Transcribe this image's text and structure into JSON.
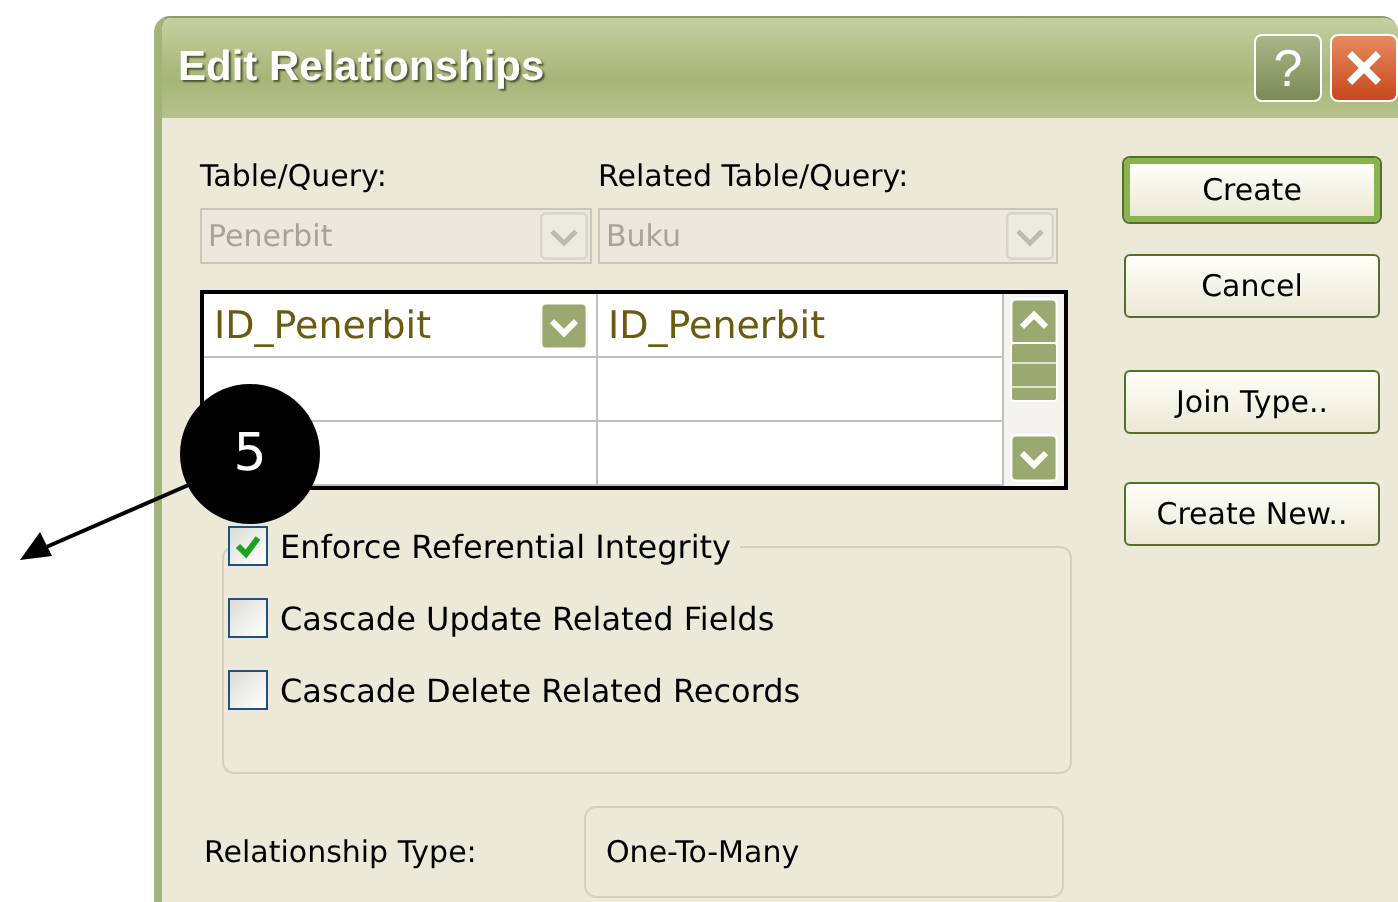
{
  "window": {
    "title": "Edit Relationships"
  },
  "help_button": {
    "label": "?"
  },
  "table_query": {
    "label": "Table/Query:",
    "value": "Penerbit",
    "disabled": true
  },
  "related_table_query": {
    "label": "Related Table/Query:",
    "value": "Buku",
    "disabled": true
  },
  "field_rows": [
    {
      "table_field": "ID_Penerbit",
      "related_field": "ID_Penerbit",
      "selected": true
    }
  ],
  "options": [
    {
      "label": "Enforce Referential Integrity",
      "checked": true
    },
    {
      "label": "Cascade Update Related Fields",
      "checked": false
    },
    {
      "label": "Cascade Delete Related Records",
      "checked": false
    }
  ],
  "relationship_type": {
    "label": "Relationship Type:",
    "value": "One-To-Many"
  },
  "buttons": [
    {
      "label": "Create",
      "default": true
    },
    {
      "label": "Cancel",
      "default": false
    },
    {
      "label": "Join Type..",
      "default": false
    },
    {
      "label": "Create New..",
      "default": false
    }
  ],
  "callout": {
    "label": "5"
  }
}
